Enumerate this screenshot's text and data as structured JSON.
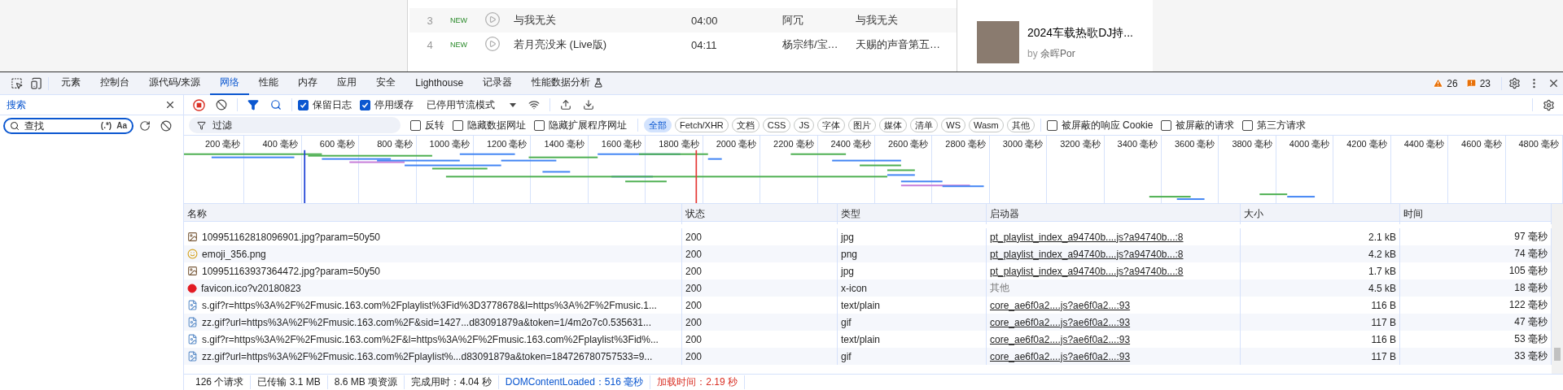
{
  "web_page": {
    "songs": [
      {
        "index": "3",
        "badge": "NEW",
        "title": "与我无关",
        "duration": "04:00",
        "artist": "阿冗",
        "album": "与我无关"
      },
      {
        "index": "4",
        "badge": "NEW",
        "title": "若月亮没来 (Live版)",
        "duration": "04:11",
        "artist": "杨宗纬/宝…",
        "album": "天赐的声音第五…"
      }
    ],
    "playlist": {
      "title": "2024车载热歌DJ持...",
      "by": "by",
      "author": "余晖Por"
    }
  },
  "devtools": {
    "tabs": [
      {
        "label": "元素",
        "selected": false
      },
      {
        "label": "控制台",
        "selected": false
      },
      {
        "label": "源代码/来源",
        "selected": false
      },
      {
        "label": "网络",
        "selected": true
      },
      {
        "label": "性能",
        "selected": false
      },
      {
        "label": "内存",
        "selected": false
      },
      {
        "label": "应用",
        "selected": false
      },
      {
        "label": "安全",
        "selected": false
      },
      {
        "label": "Lighthouse",
        "selected": false
      },
      {
        "label": "记录器",
        "selected": false
      },
      {
        "label": "性能数据分析",
        "selected": false,
        "experimental": true
      }
    ],
    "warnings": "26",
    "issues": "23",
    "sidebar": {
      "tab": "搜索",
      "placeholder": "查找",
      "regex": "(.*)",
      "match_case": "Aa"
    },
    "toolbar": {
      "recording": true,
      "filter_active": true,
      "checkboxes": [
        {
          "label": "保留日志",
          "checked": true
        },
        {
          "label": "停用缓存",
          "checked": true
        }
      ],
      "throttling": "已停用节流模式"
    },
    "filter": {
      "placeholder": "过滤",
      "checkboxes": [
        {
          "label": "反转",
          "checked": false
        },
        {
          "label": "隐藏数据网址",
          "checked": false
        },
        {
          "label": "隐藏扩展程序网址",
          "checked": false
        }
      ],
      "types": [
        {
          "label": "全部",
          "selected": true
        },
        {
          "label": "Fetch/XHR",
          "selected": false
        },
        {
          "label": "文档",
          "selected": false
        },
        {
          "label": "CSS",
          "selected": false
        },
        {
          "label": "JS",
          "selected": false
        },
        {
          "label": "字体",
          "selected": false
        },
        {
          "label": "图片",
          "selected": false
        },
        {
          "label": "媒体",
          "selected": false
        },
        {
          "label": "清单",
          "selected": false
        },
        {
          "label": "WS",
          "selected": false
        },
        {
          "label": "Wasm",
          "selected": false
        },
        {
          "label": "其他",
          "selected": false
        }
      ],
      "more_checkboxes": [
        {
          "label": "被屏蔽的响应 Cookie",
          "checked": false
        },
        {
          "label": "被屏蔽的请求",
          "checked": false
        },
        {
          "label": "第三方请求",
          "checked": false
        }
      ]
    },
    "timeline": {
      "ticks": [
        "200 毫秒",
        "400 毫秒",
        "600 毫秒",
        "800 毫秒",
        "1000 毫秒",
        "1200 毫秒",
        "1400 毫秒",
        "1600 毫秒",
        "1800 毫秒",
        "2000 毫秒",
        "2200 毫秒",
        "2400 毫秒",
        "2600 毫秒",
        "2800 毫秒",
        "3000 毫秒",
        "3200 毫秒",
        "3400 毫秒",
        "3600 毫秒",
        "3800 毫秒",
        "4000 毫秒",
        "4200 毫秒",
        "4400 毫秒",
        "4600 毫秒",
        "4800 毫秒"
      ]
    },
    "table": {
      "columns": [
        "名称",
        "状态",
        "类型",
        "启动器",
        "大小",
        "时间"
      ],
      "rows": [
        {
          "kind": "photo",
          "name": "109951162818096901.jpg?param=50y50",
          "status": "200",
          "type": "jpg",
          "initiator": "pt_playlist_index_a94740b....js?a94740b...:8",
          "initiator_linked": true,
          "size": "2.1 kB",
          "time": "97 毫秒"
        },
        {
          "kind": "emoji",
          "name": "emoji_356.png",
          "status": "200",
          "type": "png",
          "initiator": "pt_playlist_index_a94740b....js?a94740b...:8",
          "initiator_linked": true,
          "size": "4.2 kB",
          "time": "74 毫秒"
        },
        {
          "kind": "photo",
          "name": "109951163937364472.jpg?param=50y50",
          "status": "200",
          "type": "jpg",
          "initiator": "pt_playlist_index_a94740b....js?a94740b...:8",
          "initiator_linked": true,
          "size": "1.7 kB",
          "time": "105 毫秒"
        },
        {
          "kind": "favicon",
          "name": "favicon.ico?v20180823",
          "status": "200",
          "type": "x-icon",
          "initiator": "其他",
          "initiator_linked": false,
          "size": "4.5 kB",
          "time": "18 毫秒"
        },
        {
          "kind": "file",
          "name": "s.gif?r=https%3A%2F%2Fmusic.163.com%2Fplaylist%3Fid%3D3778678&l=https%3A%2F%2Fmusic.1...",
          "status": "200",
          "type": "text/plain",
          "initiator": "core_ae6f0a2....js?ae6f0a2...:93",
          "initiator_linked": true,
          "size": "116 B",
          "time": "122 毫秒"
        },
        {
          "kind": "file",
          "name": "zz.gif?url=https%3A%2F%2Fmusic.163.com%2F&sid=1427...d83091879a&token=1/4m2o7c0.535631...",
          "status": "200",
          "type": "gif",
          "initiator": "core_ae6f0a2....js?ae6f0a2...:93",
          "initiator_linked": true,
          "size": "117 B",
          "time": "47 毫秒"
        },
        {
          "kind": "file",
          "name": "s.gif?r=https%3A%2F%2Fmusic.163.com%2F&l=https%3A%2F%2Fmusic.163.com%2Fplaylist%3Fid%...",
          "status": "200",
          "type": "text/plain",
          "initiator": "core_ae6f0a2....js?ae6f0a2...:93",
          "initiator_linked": true,
          "size": "116 B",
          "time": "53 毫秒"
        },
        {
          "kind": "file",
          "name": "zz.gif?url=https%3A%2F%2Fmusic.163.com%2Fplaylist%...d83091879a&token=184726780757533=9...",
          "status": "200",
          "type": "gif",
          "initiator": "core_ae6f0a2....js?ae6f0a2...:93",
          "initiator_linked": true,
          "size": "117 B",
          "time": "33 毫秒"
        }
      ]
    },
    "status_bar": [
      {
        "text": "126 个请求",
        "kind": "plain"
      },
      {
        "text": "已传输 3.1 MB",
        "kind": "plain"
      },
      {
        "text": "8.6 MB 项资源",
        "kind": "plain"
      },
      {
        "text": "完成用时：4.04 秒",
        "kind": "plain"
      },
      {
        "text": "DOMContentLoaded：516 毫秒",
        "kind": "dom"
      },
      {
        "text": "加载时间：2.19 秒",
        "kind": "load"
      }
    ]
  }
}
